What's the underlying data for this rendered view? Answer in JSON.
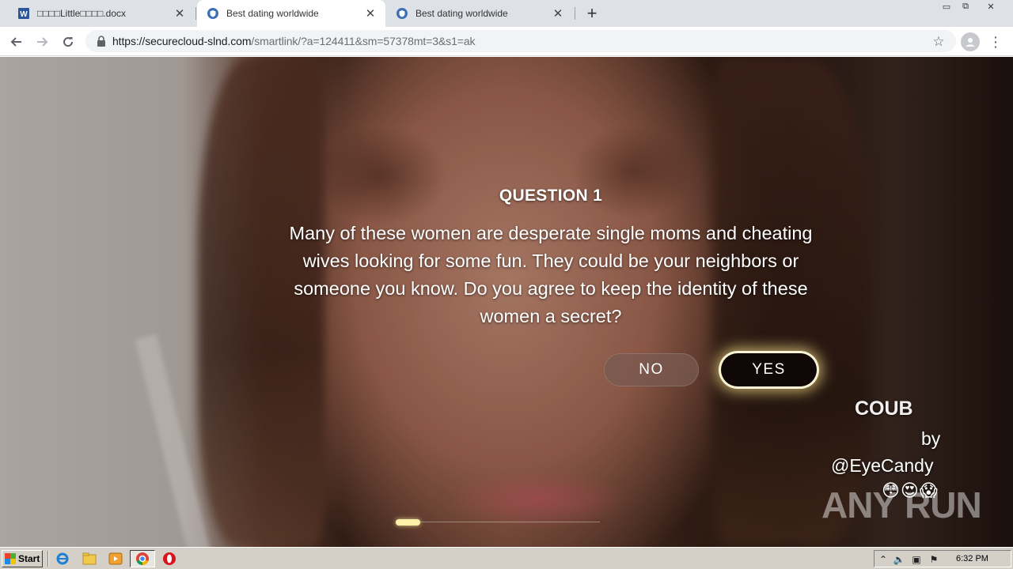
{
  "browser": {
    "tabs": [
      {
        "title": "□□□□Little□□□□.docx",
        "icon": "word-icon"
      },
      {
        "title": "Best dating worldwide",
        "icon": "site-shield-icon",
        "active": true
      },
      {
        "title": "Best dating worldwide",
        "icon": "site-shield-icon"
      }
    ],
    "new_tab": "+",
    "address": {
      "host": "https://securecloud-slnd.com",
      "path": "/smartlink/?a=124411&sm=57378mt=3&s1=ak"
    }
  },
  "page": {
    "heading": "QUESTION 1",
    "question": "Many of these women are desperate single moms and cheating wives looking for some fun. They could be your neighbors or someone you know. Do you agree to keep the identity of these women a secret?",
    "no_label": "NO",
    "yes_label": "YES",
    "promo": {
      "brand": "COUB",
      "by": "by",
      "handle": "@EyeCandy",
      "emoji": "😳😍😱"
    },
    "progress": 0.12,
    "watermark": "ANY RUN"
  },
  "taskbar": {
    "start_label": "Start",
    "clock": "6:32 PM"
  },
  "colors": {
    "yes_button_bg": "#0f0806",
    "yes_glow": "#ffe68c",
    "no_button_bg": "#785a50",
    "progress_fill": "#fff2a8"
  }
}
